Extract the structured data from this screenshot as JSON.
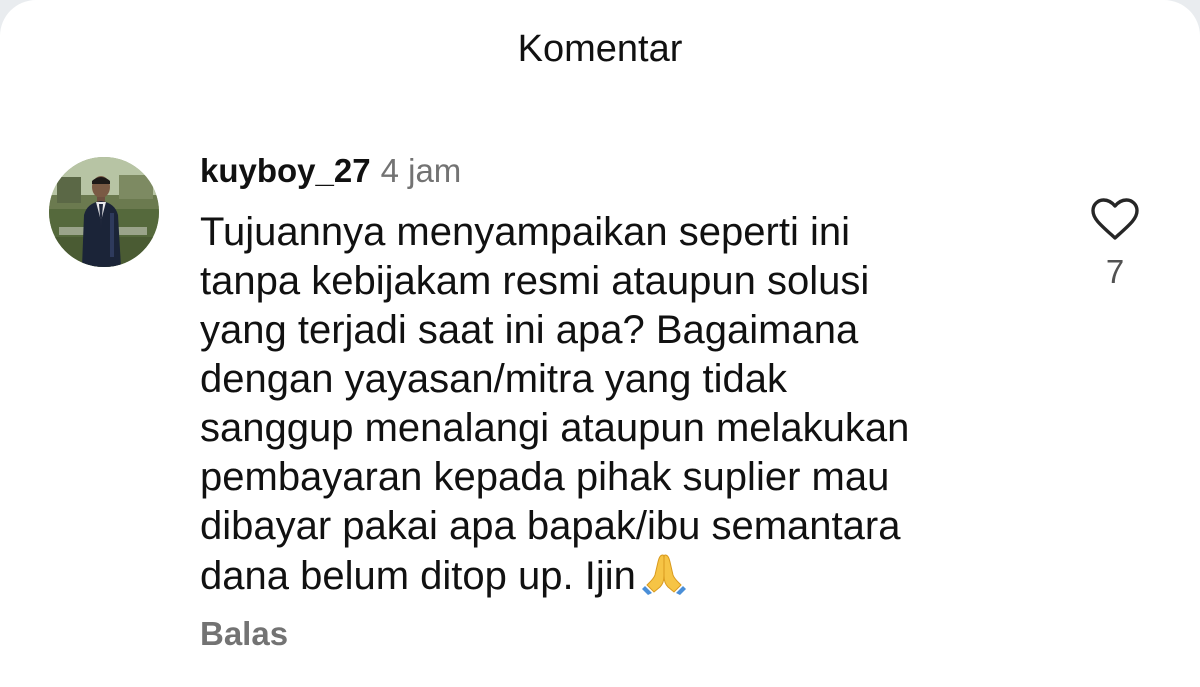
{
  "header": {
    "title": "Komentar"
  },
  "comment": {
    "username": "kuyboy_27",
    "timestamp": "4 jam",
    "avatar": "avatar-photo",
    "lines": [
      "Tujuannya menyampaikan seperti ini",
      "tanpa kebijakam resmi ataupun solusi",
      "yang terjadi saat ini apa? Bagaimana",
      "dengan yayasan/mitra yang tidak",
      "sanggup menalangi ataupun melakukan",
      "pembayaran kepada pihak suplier mau",
      "dibayar pakai apa bapak/ibu semantara",
      "dana belum ditop up. Ijin"
    ],
    "emoji": "folded-hands-icon",
    "like_icon": "heart-outline-icon",
    "like_count": "7",
    "reply_label": "Balas"
  },
  "colors": {
    "text_primary": "#111111",
    "text_secondary": "#737373",
    "like_count": "#525252",
    "background": "#ffffff"
  }
}
